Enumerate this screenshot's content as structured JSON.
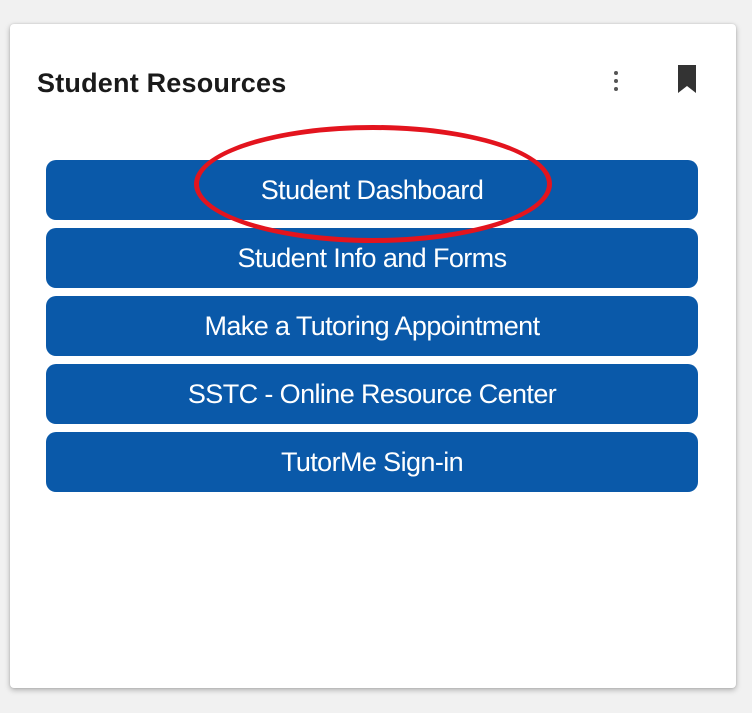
{
  "card": {
    "title": "Student Resources"
  },
  "icons": {
    "menu": "more-vertical-icon",
    "bookmark": "bookmark-icon"
  },
  "buttons": [
    {
      "label": "Student Dashboard"
    },
    {
      "label": "Student Info and Forms"
    },
    {
      "label": "Make a Tutoring Appointment"
    },
    {
      "label": "SSTC - Online Resource Center"
    },
    {
      "label": "TutorMe Sign-in"
    }
  ],
  "annotation": {
    "highlighted_item": "Student Dashboard",
    "color": "#e3141e"
  },
  "colors": {
    "button_bg": "#0a59a9",
    "button_text": "#ffffff",
    "title_text": "#1a1a1a"
  }
}
